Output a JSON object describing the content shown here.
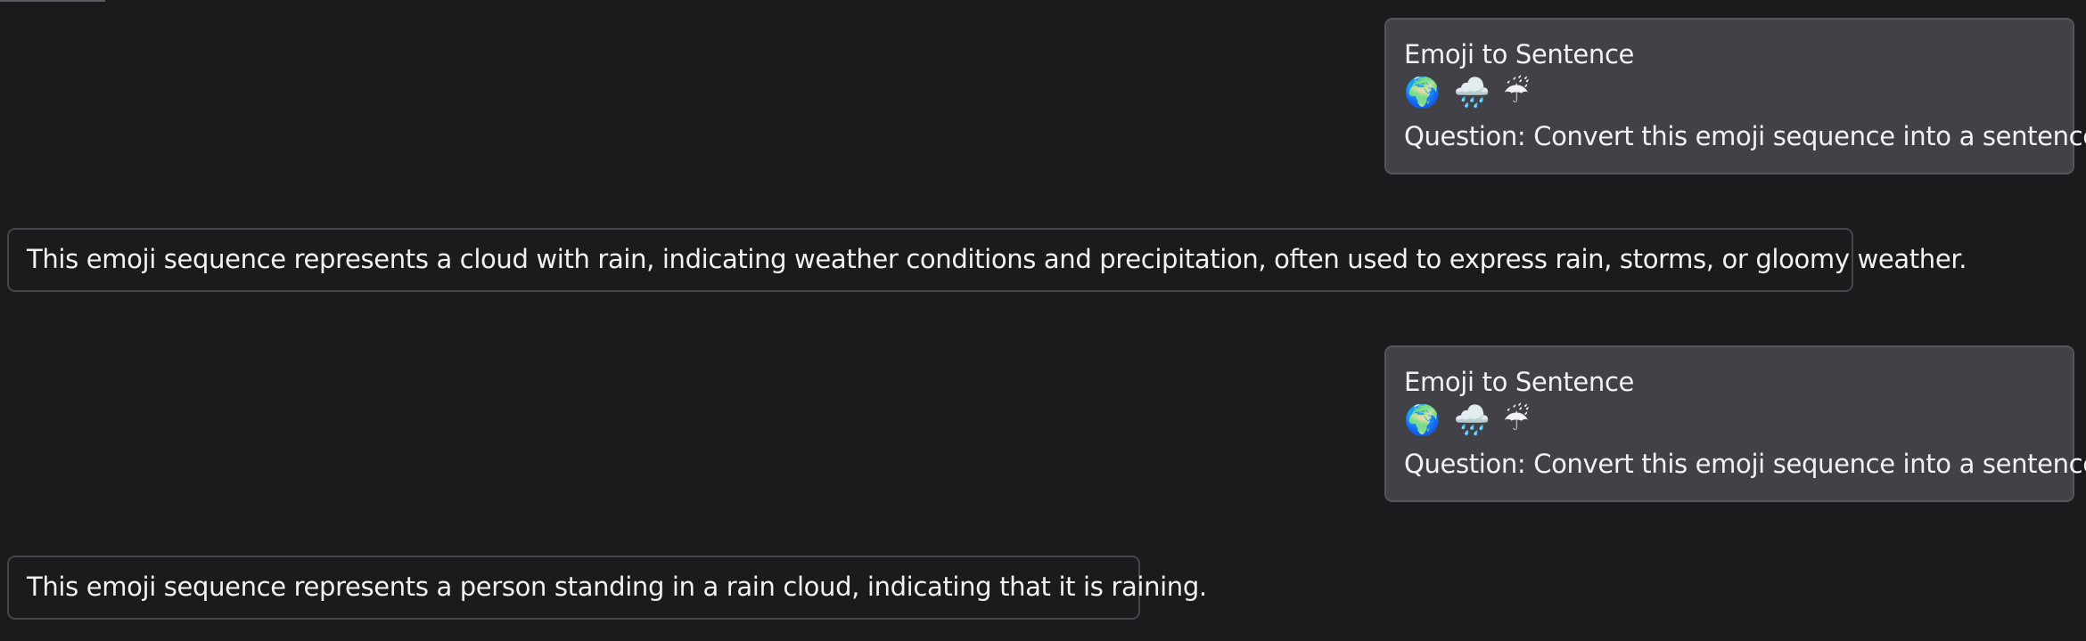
{
  "conversation": {
    "messages": [
      {
        "role": "user",
        "title": "Emoji to Sentence",
        "emojis": "🌍 🌧️ ☔",
        "question": "Question: Convert this emoji sequence into a sentence."
      },
      {
        "role": "assistant",
        "text": "This emoji sequence represents a cloud with rain, indicating weather conditions and precipitation, often used to express rain, storms, or gloomy weather."
      },
      {
        "role": "user",
        "title": "Emoji to Sentence",
        "emojis": "🌍 🌧️ ☔",
        "question": "Question: Convert this emoji sequence into a sentence."
      },
      {
        "role": "assistant",
        "text": "This emoji sequence represents a person standing in a rain cloud, indicating that it is raining."
      }
    ]
  },
  "theme": {
    "background": "#1b1b1e",
    "user_bubble": "#424148",
    "border": "#46464c",
    "text": "#f2f2f4"
  }
}
